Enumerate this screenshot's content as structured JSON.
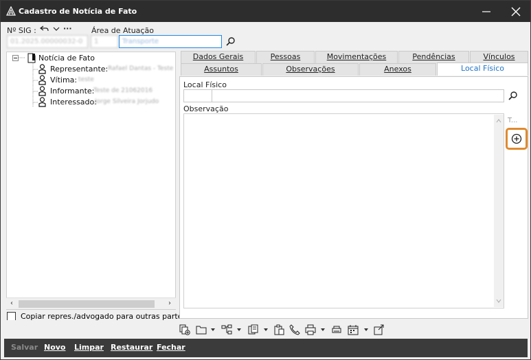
{
  "window": {
    "title": "Cadastro de Notícia de Fato"
  },
  "header": {
    "sig_label": "Nº SIG :",
    "sig_value": "01.2025.00000032-0",
    "area_label": "Área de Atuação",
    "area_code": "1",
    "area_value": "Transporte",
    "nav_more": "···"
  },
  "tree": {
    "root_label": "Notícia de Fato",
    "items": [
      {
        "label": "Representante:",
        "value": "Rafael Dantas - Teste"
      },
      {
        "label": "Vítima:",
        "value": "teste"
      },
      {
        "label": "Informante:",
        "value": "Teste de 21062016"
      },
      {
        "label": "Interessado:",
        "value": "Jorge Silveira Jorjudo"
      }
    ]
  },
  "copy_checkbox": {
    "label": "Copiar repres./advogado para outras partes",
    "checked": false
  },
  "tabs": {
    "row1": [
      "Dados Gerais",
      "Pessoas",
      "Movimentações",
      "Pendências",
      "Vínculos"
    ],
    "row2": [
      "Assuntos",
      "Observações",
      "Anexos",
      "Local Físico"
    ],
    "active": "Local Físico"
  },
  "local_fisico": {
    "label": "Local Físico",
    "code_value": "",
    "desc_value": "",
    "observacao_label": "Observação",
    "observacao_value": "",
    "side_label": "T..."
  },
  "actions": {
    "salvar": "Salvar",
    "novo": "Novo",
    "limpar": "Limpar",
    "restaurar": "Restaurar",
    "fechar": "Fechar"
  },
  "colors": {
    "titlebar": "#2d2d2d",
    "accent": "#1e74c8",
    "highlight": "#e08a2e",
    "actionbar": "#3b3b3b"
  }
}
